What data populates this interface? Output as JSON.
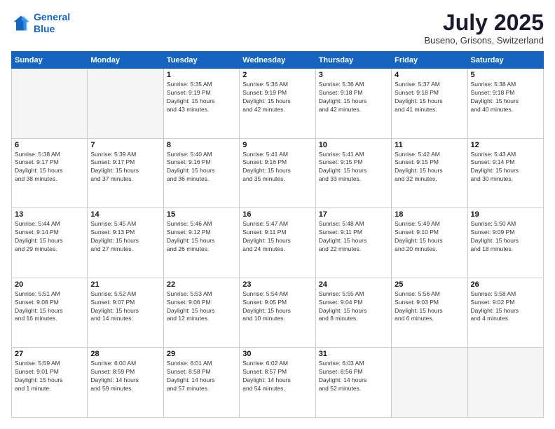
{
  "header": {
    "logo_line1": "General",
    "logo_line2": "Blue",
    "month": "July 2025",
    "location": "Buseno, Grisons, Switzerland"
  },
  "weekdays": [
    "Sunday",
    "Monday",
    "Tuesday",
    "Wednesday",
    "Thursday",
    "Friday",
    "Saturday"
  ],
  "weeks": [
    [
      {
        "day": "",
        "info": ""
      },
      {
        "day": "",
        "info": ""
      },
      {
        "day": "1",
        "info": "Sunrise: 5:35 AM\nSunset: 9:19 PM\nDaylight: 15 hours\nand 43 minutes."
      },
      {
        "day": "2",
        "info": "Sunrise: 5:36 AM\nSunset: 9:19 PM\nDaylight: 15 hours\nand 42 minutes."
      },
      {
        "day": "3",
        "info": "Sunrise: 5:36 AM\nSunset: 9:18 PM\nDaylight: 15 hours\nand 42 minutes."
      },
      {
        "day": "4",
        "info": "Sunrise: 5:37 AM\nSunset: 9:18 PM\nDaylight: 15 hours\nand 41 minutes."
      },
      {
        "day": "5",
        "info": "Sunrise: 5:38 AM\nSunset: 9:18 PM\nDaylight: 15 hours\nand 40 minutes."
      }
    ],
    [
      {
        "day": "6",
        "info": "Sunrise: 5:38 AM\nSunset: 9:17 PM\nDaylight: 15 hours\nand 38 minutes."
      },
      {
        "day": "7",
        "info": "Sunrise: 5:39 AM\nSunset: 9:17 PM\nDaylight: 15 hours\nand 37 minutes."
      },
      {
        "day": "8",
        "info": "Sunrise: 5:40 AM\nSunset: 9:16 PM\nDaylight: 15 hours\nand 36 minutes."
      },
      {
        "day": "9",
        "info": "Sunrise: 5:41 AM\nSunset: 9:16 PM\nDaylight: 15 hours\nand 35 minutes."
      },
      {
        "day": "10",
        "info": "Sunrise: 5:41 AM\nSunset: 9:15 PM\nDaylight: 15 hours\nand 33 minutes."
      },
      {
        "day": "11",
        "info": "Sunrise: 5:42 AM\nSunset: 9:15 PM\nDaylight: 15 hours\nand 32 minutes."
      },
      {
        "day": "12",
        "info": "Sunrise: 5:43 AM\nSunset: 9:14 PM\nDaylight: 15 hours\nand 30 minutes."
      }
    ],
    [
      {
        "day": "13",
        "info": "Sunrise: 5:44 AM\nSunset: 9:14 PM\nDaylight: 15 hours\nand 29 minutes."
      },
      {
        "day": "14",
        "info": "Sunrise: 5:45 AM\nSunset: 9:13 PM\nDaylight: 15 hours\nand 27 minutes."
      },
      {
        "day": "15",
        "info": "Sunrise: 5:46 AM\nSunset: 9:12 PM\nDaylight: 15 hours\nand 26 minutes."
      },
      {
        "day": "16",
        "info": "Sunrise: 5:47 AM\nSunset: 9:11 PM\nDaylight: 15 hours\nand 24 minutes."
      },
      {
        "day": "17",
        "info": "Sunrise: 5:48 AM\nSunset: 9:11 PM\nDaylight: 15 hours\nand 22 minutes."
      },
      {
        "day": "18",
        "info": "Sunrise: 5:49 AM\nSunset: 9:10 PM\nDaylight: 15 hours\nand 20 minutes."
      },
      {
        "day": "19",
        "info": "Sunrise: 5:50 AM\nSunset: 9:09 PM\nDaylight: 15 hours\nand 18 minutes."
      }
    ],
    [
      {
        "day": "20",
        "info": "Sunrise: 5:51 AM\nSunset: 9:08 PM\nDaylight: 15 hours\nand 16 minutes."
      },
      {
        "day": "21",
        "info": "Sunrise: 5:52 AM\nSunset: 9:07 PM\nDaylight: 15 hours\nand 14 minutes."
      },
      {
        "day": "22",
        "info": "Sunrise: 5:53 AM\nSunset: 9:06 PM\nDaylight: 15 hours\nand 12 minutes."
      },
      {
        "day": "23",
        "info": "Sunrise: 5:54 AM\nSunset: 9:05 PM\nDaylight: 15 hours\nand 10 minutes."
      },
      {
        "day": "24",
        "info": "Sunrise: 5:55 AM\nSunset: 9:04 PM\nDaylight: 15 hours\nand 8 minutes."
      },
      {
        "day": "25",
        "info": "Sunrise: 5:56 AM\nSunset: 9:03 PM\nDaylight: 15 hours\nand 6 minutes."
      },
      {
        "day": "26",
        "info": "Sunrise: 5:58 AM\nSunset: 9:02 PM\nDaylight: 15 hours\nand 4 minutes."
      }
    ],
    [
      {
        "day": "27",
        "info": "Sunrise: 5:59 AM\nSunset: 9:01 PM\nDaylight: 15 hours\nand 1 minute."
      },
      {
        "day": "28",
        "info": "Sunrise: 6:00 AM\nSunset: 8:59 PM\nDaylight: 14 hours\nand 59 minutes."
      },
      {
        "day": "29",
        "info": "Sunrise: 6:01 AM\nSunset: 8:58 PM\nDaylight: 14 hours\nand 57 minutes."
      },
      {
        "day": "30",
        "info": "Sunrise: 6:02 AM\nSunset: 8:57 PM\nDaylight: 14 hours\nand 54 minutes."
      },
      {
        "day": "31",
        "info": "Sunrise: 6:03 AM\nSunset: 8:56 PM\nDaylight: 14 hours\nand 52 minutes."
      },
      {
        "day": "",
        "info": ""
      },
      {
        "day": "",
        "info": ""
      }
    ]
  ]
}
